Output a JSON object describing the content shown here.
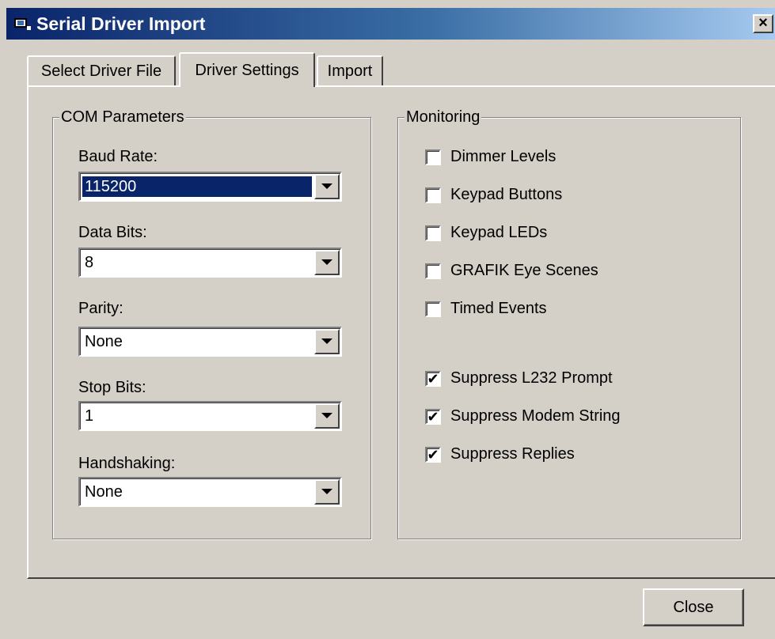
{
  "window": {
    "title": "Serial Driver Import",
    "close_glyph": "×"
  },
  "tabs": [
    {
      "label": "Select Driver File"
    },
    {
      "label": "Driver Settings"
    },
    {
      "label": "Import"
    }
  ],
  "com": {
    "legend": "COM Parameters",
    "fields": [
      {
        "label": "Baud Rate:",
        "value": "115200"
      },
      {
        "label": "Data Bits:",
        "value": "8"
      },
      {
        "label": "Parity:",
        "value": "None"
      },
      {
        "label": "Stop Bits:",
        "value": "1"
      },
      {
        "label": "Handshaking:",
        "value": "None"
      }
    ]
  },
  "monitoring": {
    "legend": "Monitoring",
    "options": [
      {
        "label": "Dimmer Levels",
        "checked": false
      },
      {
        "label": "Keypad Buttons",
        "checked": false
      },
      {
        "label": "Keypad LEDs",
        "checked": false
      },
      {
        "label": "GRAFIK Eye Scenes",
        "checked": false
      },
      {
        "label": "Timed Events",
        "checked": false
      },
      {
        "label": "Suppress L232 Prompt",
        "checked": true
      },
      {
        "label": "Suppress Modem String",
        "checked": true
      },
      {
        "label": "Suppress Replies",
        "checked": true
      }
    ],
    "check_glyph": "✔"
  },
  "footer": {
    "close_label": "Close"
  },
  "icons": {
    "app_icon": "serial-driver-icon",
    "close_icon": "close-icon",
    "dropdown_icon": "chevron-down-icon"
  }
}
